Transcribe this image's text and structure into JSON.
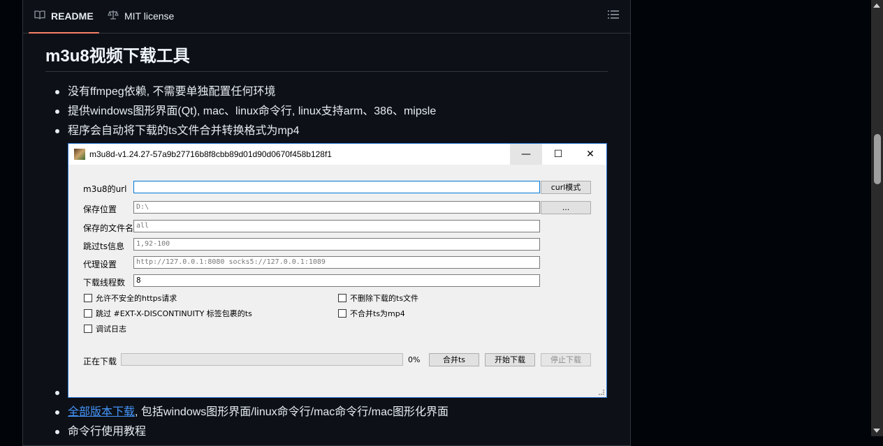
{
  "tabs": {
    "readme": "README",
    "license": "MIT license"
  },
  "heading": "m3u8视频下载工具",
  "bullets": [
    "没有ffmpeg依赖, 不需要单独配置任何环境",
    "提供windows图形界面(Qt), mac、linux命令行, linux支持arm、386、mipsle",
    "程序会自动将下载的ts文件合并转换格式为mp4"
  ],
  "lower": {
    "download_link": "全部版本下载",
    "download_rest": ", 包括windows图形界面/linux命令行/mac命令行/mac图形化界面",
    "tutorial": "命令行使用教程"
  },
  "app": {
    "title": "m3u8d-v1.24.27-57a9b27716b8f8cbb89d01d90d0670f458b128f1",
    "window_buttons": {
      "minimize": "—",
      "maximize": "☐",
      "close": "✕"
    },
    "fields": {
      "url_label": "m3u8的url",
      "url_value": "",
      "curl_button": "curl模式",
      "save_dir_label": "保存位置",
      "save_dir_value": "D:\\",
      "browse_button": "...",
      "filename_label": "保存的文件名",
      "filename_value": "all",
      "skip_label": "跳过ts信息",
      "skip_value": "1,92-100",
      "proxy_label": "代理设置",
      "proxy_value": "http://127.0.0.1:8080 socks5://127.0.0.1:1089",
      "threads_label": "下载线程数",
      "threads_value": "8"
    },
    "checkboxes": {
      "insecure_https": "允许不安全的https请求",
      "keep_ts": "不删除下载的ts文件",
      "skip_discontinuity": "跳过 #EXT-X-DISCONTINUITY 标签包裹的ts",
      "no_merge_mp4": "不合并ts为mp4",
      "debug_log": "调试日志"
    },
    "progress": {
      "label": "正在下载",
      "percent": "0%",
      "value": 0
    },
    "buttons": {
      "merge_ts": "合并ts",
      "start": "开始下载",
      "stop": "停止下载"
    }
  }
}
